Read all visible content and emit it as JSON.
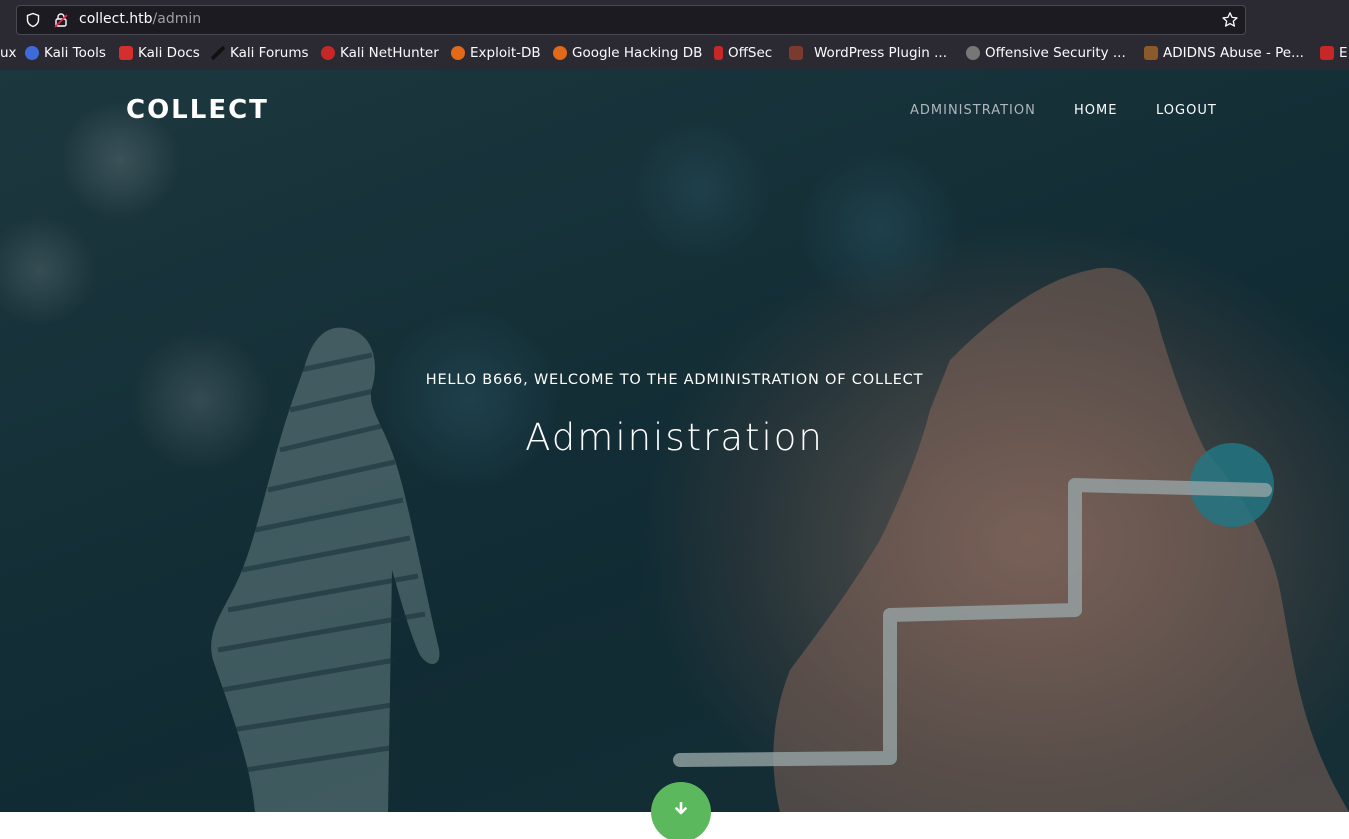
{
  "browser": {
    "url_host": "collect.htb",
    "url_path": "/admin",
    "icons": {
      "tracking": "shield-icon",
      "lock": "lock-insecure-icon",
      "bookmark": "star-icon"
    },
    "bookmarks": [
      {
        "label": "ux",
        "color": "#2b2a33"
      },
      {
        "label": "Kali Tools",
        "color": "#3f6bd8"
      },
      {
        "label": "Kali Docs",
        "color": "#d32f2f"
      },
      {
        "label": "Kali Forums",
        "color": "#222222"
      },
      {
        "label": "Kali NetHunter",
        "color": "#c62828"
      },
      {
        "label": "Exploit-DB",
        "color": "#e0691a"
      },
      {
        "label": "Google Hacking DB",
        "color": "#e0691a"
      },
      {
        "label": "OffSec",
        "color": "#c62828"
      },
      {
        "label": "WordPress Plugin ...",
        "color": "#7a3b2e"
      },
      {
        "label": "Offensive Security ...",
        "color": "#777777"
      },
      {
        "label": "ADIDNS Abuse - Pe...",
        "color": "#8a5a2b"
      },
      {
        "label": "E",
        "color": "#c62828"
      }
    ]
  },
  "site": {
    "brand": "COLLECT",
    "nav": {
      "administration": "ADMINISTRATION",
      "home": "HOME",
      "logout": "LOGOUT"
    },
    "hero": {
      "greeting": "HELLO B666, WELCOME TO THE ADMINISTRATION OF COLLECT",
      "title": "Administration"
    },
    "accent_color": "#5cb85c",
    "scroll_icon": "arrow-down-icon"
  }
}
